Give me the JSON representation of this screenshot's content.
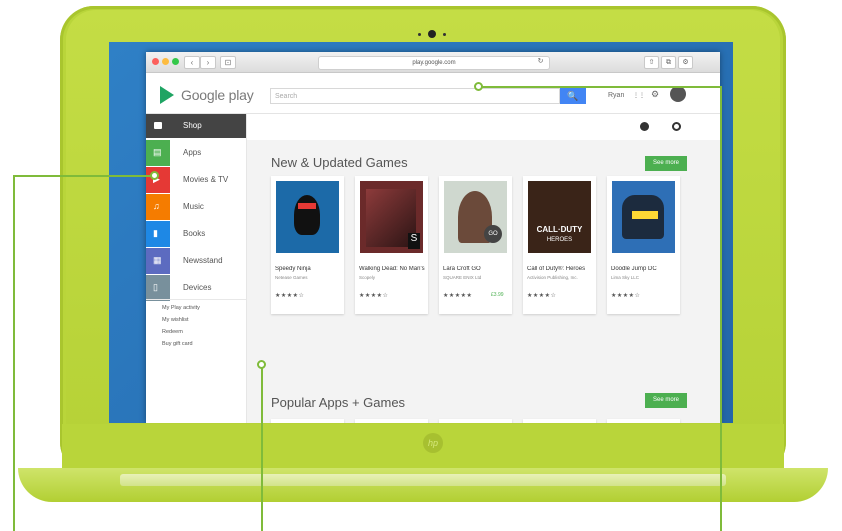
{
  "browser": {
    "url": "play.google.com",
    "back_label": "‹",
    "forward_label": "›",
    "sidebar_toggle_label": "⊡",
    "refresh_label": "↻",
    "share_label": "⇧",
    "tabs_label": "⧉",
    "settings_label": "⚙"
  },
  "header": {
    "logo_text": "Google play",
    "search_placeholder": "Search",
    "search_button": "🔍",
    "user_name": "Ryan",
    "apps_grid_icon": "⋮⋮",
    "settings_icon": "⚙"
  },
  "sidebar": {
    "shop_label": "Shop",
    "items": [
      {
        "label": "Apps",
        "color": "#4caf50",
        "icon": "android-icon",
        "glyph": "▤"
      },
      {
        "label": "Movies & TV",
        "color": "#e53935",
        "icon": "movie-icon",
        "glyph": "▶"
      },
      {
        "label": "Music",
        "color": "#f57c00",
        "icon": "headphones-icon",
        "glyph": "♫"
      },
      {
        "label": "Books",
        "color": "#1e88e5",
        "icon": "book-icon",
        "glyph": "▮"
      },
      {
        "label": "Newsstand",
        "color": "#5c6bc0",
        "icon": "newspaper-icon",
        "glyph": "▦"
      },
      {
        "label": "Devices",
        "color": "#78909c",
        "icon": "device-icon",
        "glyph": "▯"
      }
    ],
    "links": [
      "My Play activity",
      "My wishlist",
      "Redeem",
      "Buy gift card"
    ]
  },
  "main": {
    "sections": [
      {
        "title": "New & Updated Games",
        "see_more": "See more"
      },
      {
        "title": "Popular Apps + Games",
        "see_more": "See more"
      }
    ],
    "games": [
      {
        "title": "Speedy Ninja",
        "developer": "Netease Games",
        "stars": "★★★★☆",
        "price": "",
        "thumb": "#1c6aa8"
      },
      {
        "title": "Walking Dead: No Man's",
        "developer": "Scopely",
        "stars": "★★★★☆",
        "price": "",
        "thumb": "#6b2a2a"
      },
      {
        "title": "Lara Croft GO",
        "developer": "SQUARE ENIX Ltd",
        "stars": "★★★★★",
        "price": "£3.99",
        "thumb": "#cfd8cf"
      },
      {
        "title": "Call of Duty®: Heroes",
        "developer": "Activision Publishing, Inc.",
        "stars": "★★★★☆",
        "price": "",
        "thumb": "#3a2418"
      },
      {
        "title": "Doodle Jump DC",
        "developer": "Lima Sky LLC",
        "stars": "★★★★☆",
        "price": "",
        "thumb": "#2e6fb6"
      }
    ],
    "popular": [
      {
        "name": "red-app-icon",
        "color": "#e53935"
      },
      {
        "name": "pink-character-icon",
        "color": "#e84a7a"
      },
      {
        "name": "blue-ring-icon",
        "color": "#1e88e5"
      },
      {
        "name": "taxi-icon",
        "color": "#fdd835"
      },
      {
        "name": "pou-icon",
        "color": "#b8894a"
      }
    ],
    "cod_logo_text": "CALL·DUTY",
    "cod_logo_sub": "HEROES",
    "walking_dead_badge": "S",
    "lara_go_badge": "GO"
  },
  "laptop": {
    "brand": "hp",
    "body_color": "#b9d53a",
    "callout_color": "#7fbb3a"
  }
}
